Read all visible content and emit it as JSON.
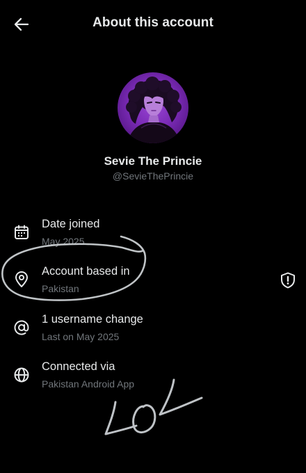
{
  "header": {
    "title": "About this account",
    "back_icon": "arrow-left-icon"
  },
  "profile": {
    "name": "Sevie The Princie",
    "handle": "@SevieThePrincie"
  },
  "rows": [
    {
      "icon": "calendar-icon",
      "title": "Date joined",
      "subtitle": "May 2025"
    },
    {
      "icon": "location-pin-icon",
      "title": "Account based in",
      "subtitle": "Pakistan"
    },
    {
      "icon": "at-sign-icon",
      "title": "1 username change",
      "subtitle": "Last on May 2025"
    },
    {
      "icon": "globe-icon",
      "title": "Connected via",
      "subtitle": "Pakistan Android App"
    }
  ],
  "annotation": {
    "handwritten_text": "LOL"
  },
  "colors": {
    "background": "#000000",
    "primary_text": "#e7e9ea",
    "secondary_text": "#71767b",
    "avatar_accent": "#8a3bc8"
  }
}
